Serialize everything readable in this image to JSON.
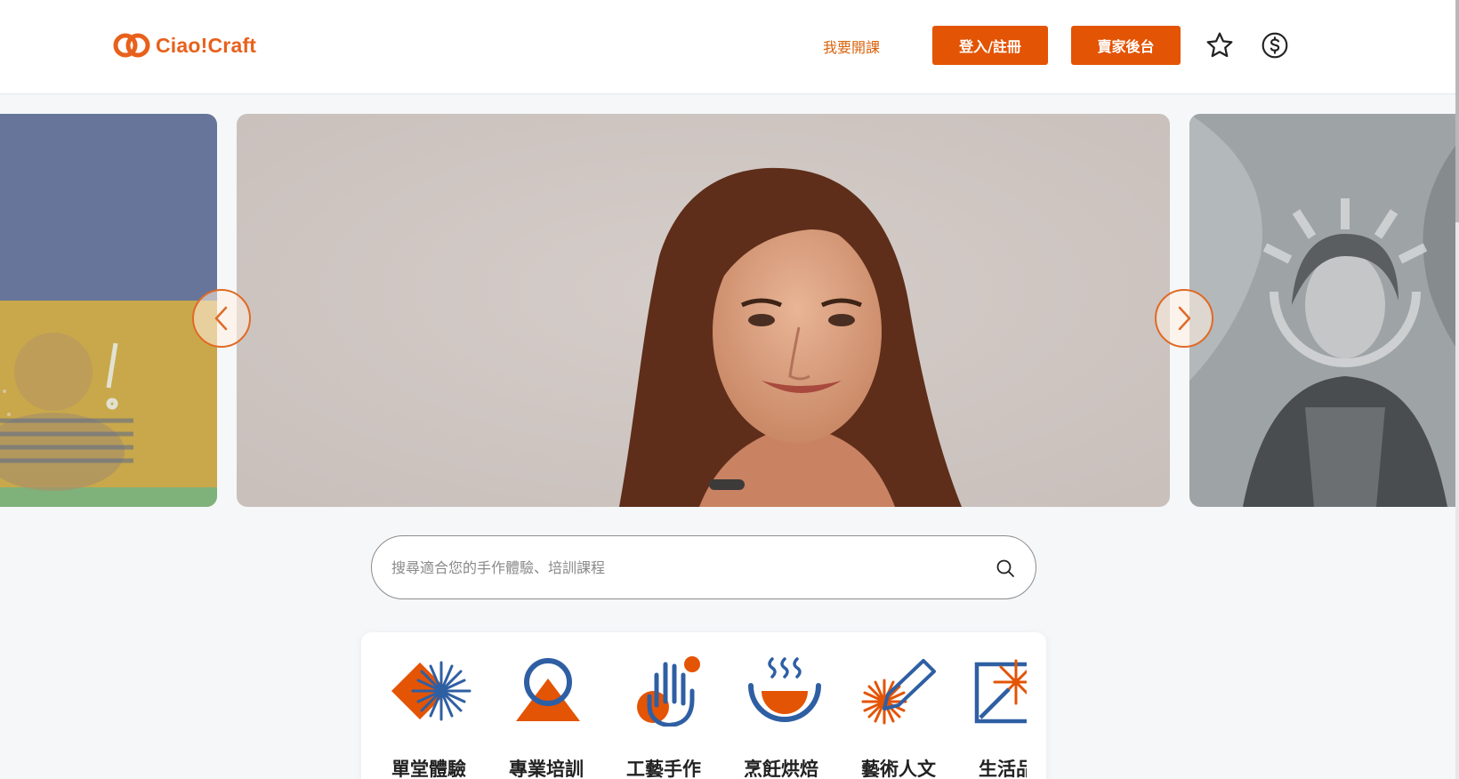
{
  "brand": {
    "name": "Ciao!Craft",
    "accent": "#e35405",
    "secondary": "#2f5fa3"
  },
  "header": {
    "teach_link": "我要開課",
    "login_button": "登入/註冊",
    "seller_button": "賣家後台",
    "icons": [
      "star-icon",
      "dollar-icon"
    ]
  },
  "carousel": {
    "slides": [
      "slide-left-partial",
      "slide-main-portrait",
      "slide-right-partial"
    ],
    "active_index": 1
  },
  "search": {
    "placeholder": "搜尋適合您的手作體驗、培訓課程",
    "value": ""
  },
  "categories": [
    {
      "label": "單堂體驗",
      "icon": "sparkle-diamond-icon"
    },
    {
      "label": "專業培訓",
      "icon": "circle-triangle-icon"
    },
    {
      "label": "工藝手作",
      "icon": "hand-icon"
    },
    {
      "label": "烹飪烘焙",
      "icon": "steaming-bowl-icon"
    },
    {
      "label": "藝術人文",
      "icon": "pen-burst-icon"
    },
    {
      "label": "生活品味",
      "icon": "frame-burst-icon"
    }
  ]
}
